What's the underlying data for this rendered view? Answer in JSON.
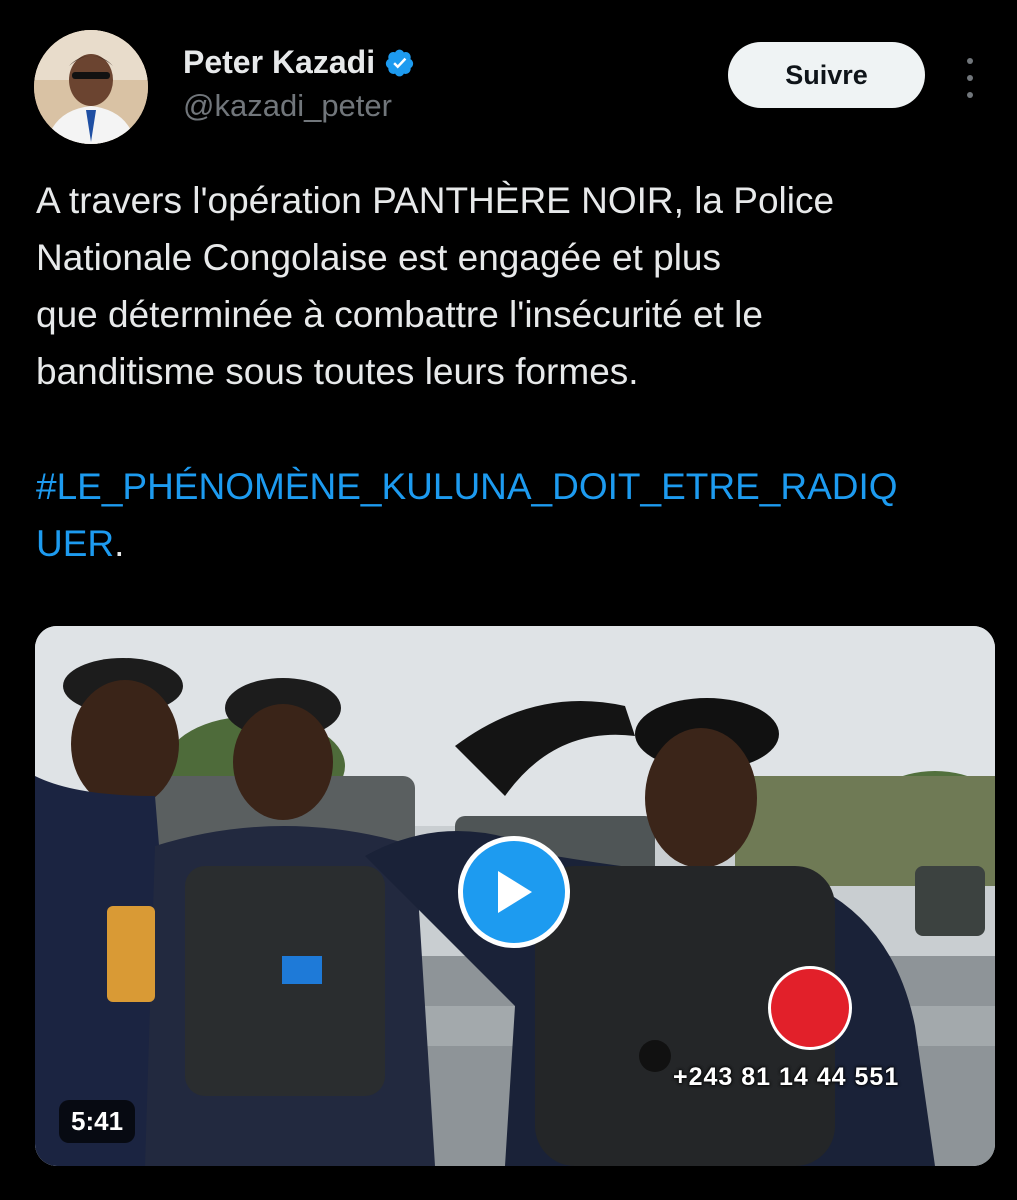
{
  "author": {
    "display_name": "Peter Kazadi",
    "handle": "@kazadi_peter",
    "verified": true,
    "avatar": "profile-photo"
  },
  "actions": {
    "follow_label": "Suivre",
    "more_icon": "more-vertical-icon"
  },
  "tweet": {
    "text_lines": [
      "A travers l'opération PANTHÈRE NOIR, la Police",
      "Nationale Congolaise est engagée et plus",
      "que déterminée à combattre l'insécurité et le",
      "banditisme sous toutes leurs formes."
    ],
    "hashtag_line1": "#LE_PHÉNOMÈNE_KULUNA_DOIT_ETRE_RADIQ",
    "hashtag_line2": "UER",
    "hashtag_suffix": "."
  },
  "video": {
    "duration": "5:41",
    "overlay_phone": "+243 81 14 44 551",
    "play_icon": "play-icon"
  },
  "colors": {
    "background": "#000000",
    "text": "#e7e9ea",
    "secondary": "#71767b",
    "link": "#1d9bf0",
    "follow_bg": "#eff3f4"
  }
}
